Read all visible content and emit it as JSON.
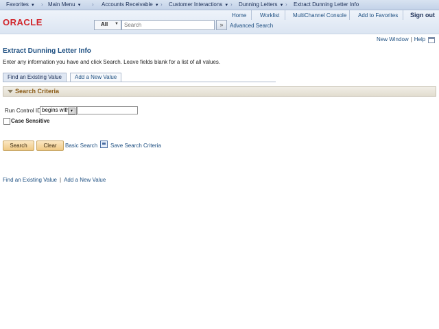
{
  "breadcrumb": {
    "favorites": "Favorites",
    "main_menu": "Main Menu",
    "accounts_receivable": "Accounts Receivable",
    "customer_interactions": "Customer Interactions",
    "dunning_letters": "Dunning Letters",
    "current": "Extract Dunning Letter Info",
    "separator": "›"
  },
  "header": {
    "logo": "ORACLE",
    "links": {
      "home": "Home",
      "worklist": "Worklist",
      "multichannel": "MultiChannel Console",
      "add_favorites": "Add to Favorites",
      "sign_out": "Sign out"
    },
    "search": {
      "scope": "All",
      "placeholder": "Search",
      "advanced": "Advanced Search"
    }
  },
  "util": {
    "new_window": "New Window",
    "help": "Help",
    "separator": "|"
  },
  "page": {
    "title": "Extract Dunning Letter Info",
    "instructions": "Enter any information you have and click Search. Leave fields blank for a list of all values."
  },
  "tabs": {
    "find": "Find an Existing Value",
    "add": "Add a New Value"
  },
  "criteria": {
    "title": "Search Criteria",
    "run_control_label": "Run Control ID",
    "operator": "begins with",
    "run_control_value": "",
    "case_sensitive_label": "Case Sensitive",
    "case_sensitive_checked": false
  },
  "actions": {
    "search": "Search",
    "clear": "Clear",
    "basic_search": "Basic Search",
    "save_search": "Save Search Criteria"
  },
  "bottom": {
    "find": "Find an Existing Value",
    "add": "Add a New Value",
    "separator": "|"
  },
  "icons": {
    "dropdown": "chevron-down-icon",
    "search_go": "double-chevron-right-icon",
    "new_window": "new-window-icon",
    "save_search": "save-search-icon",
    "collapse": "collapse-triangle-icon"
  },
  "colors": {
    "brand_red": "#d1242a",
    "link_blue": "#1c4e80",
    "button_orange": "#f0c985",
    "section_title": "#8a5a14"
  }
}
